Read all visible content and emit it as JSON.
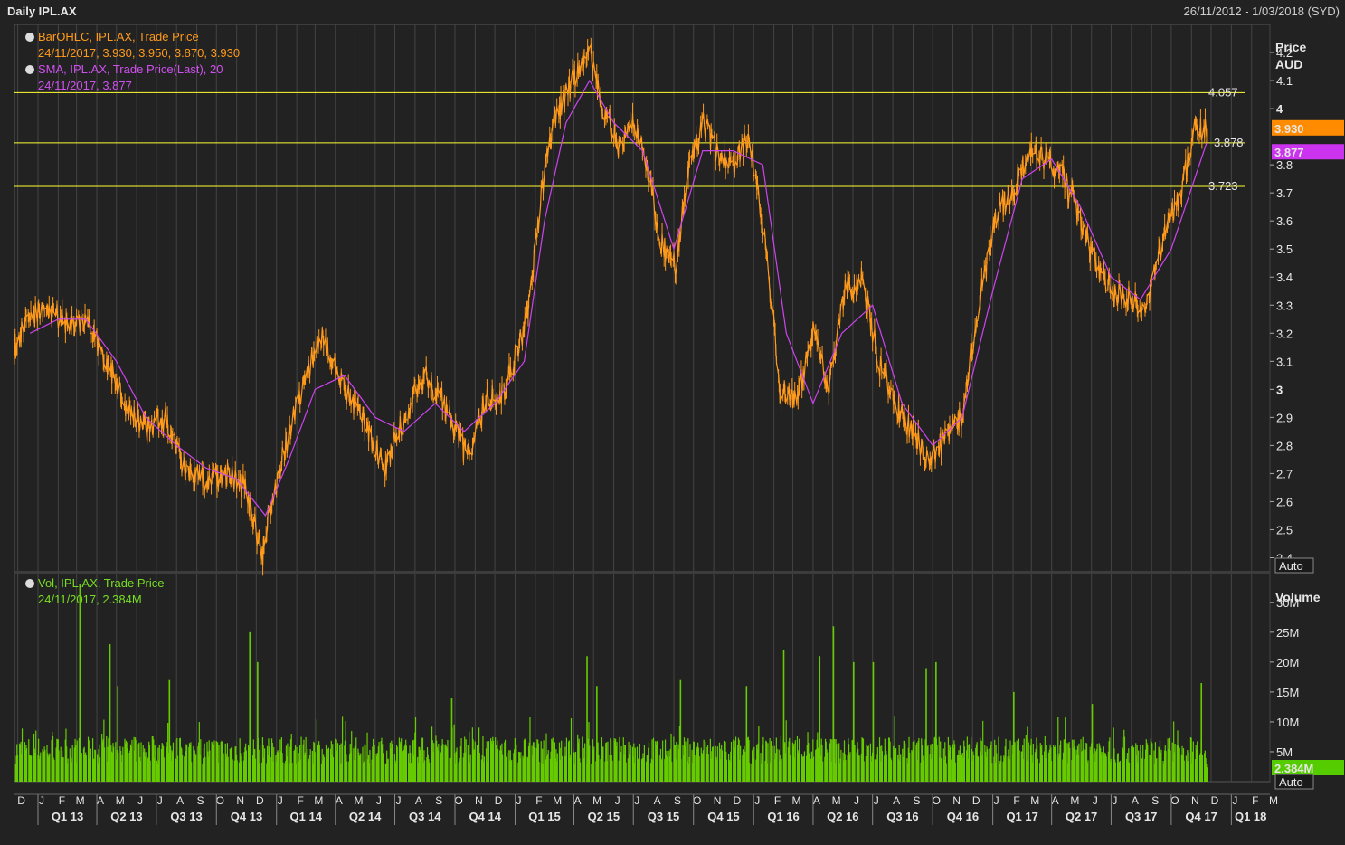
{
  "header": {
    "title": "Daily IPL.AX",
    "date_range": "26/11/2012 - 1/03/2018 (SYD)"
  },
  "legend": {
    "ohlc_label": "BarOHLC, IPL.AX, Trade Price",
    "ohlc_value": "24/11/2017, 3.930, 3.950, 3.870, 3.930",
    "sma_label": "SMA, IPL.AX, Trade Price(Last),  20",
    "sma_value": "24/11/2017, 3.877",
    "vol_label": "Vol, IPL.AX, Trade Price",
    "vol_value": "24/11/2017, 2.384M"
  },
  "colors": {
    "background": "#222222",
    "grid": "#444444",
    "price": "#ff9a1a",
    "sma": "#cc44ee",
    "volume": "#66cc00",
    "hlines": "#ffff33",
    "price_badge": "#ff8c00",
    "sma_badge": "#cc33ee",
    "volume_badge": "#55cc00"
  },
  "price_axis": {
    "title": "Price",
    "unit": "AUD",
    "ticks": [
      "2.4",
      "2.5",
      "2.6",
      "2.7",
      "2.8",
      "2.9",
      "3",
      "3.1",
      "3.2",
      "3.3",
      "3.4",
      "3.5",
      "3.6",
      "3.7",
      "3.8",
      "4",
      "4.1",
      "4.2"
    ],
    "auto_label": "Auto"
  },
  "volume_axis": {
    "title": "Volume",
    "ticks": [
      "5M",
      "10M",
      "15M",
      "20M",
      "25M",
      "30M"
    ],
    "auto_label": "Auto"
  },
  "badges": {
    "last_price": "3.930",
    "last_sma": "3.877",
    "last_volume": "2.384M"
  },
  "hline_labels": [
    "4.057",
    "3.878",
    "3.723"
  ],
  "month_labels": [
    "D",
    "J",
    "F",
    "M",
    "A",
    "M",
    "J",
    "J",
    "A",
    "S",
    "O",
    "N",
    "D",
    "J",
    "F",
    "M",
    "A",
    "M",
    "J",
    "J",
    "A",
    "S",
    "O",
    "N",
    "D",
    "J",
    "F",
    "M",
    "A",
    "M",
    "J",
    "J",
    "A",
    "S",
    "O",
    "N",
    "D",
    "J",
    "F",
    "M",
    "A",
    "M",
    "J",
    "J",
    "A",
    "S",
    "O",
    "N",
    "D",
    "J",
    "F",
    "M",
    "A",
    "M",
    "J",
    "J",
    "A",
    "S",
    "O",
    "N",
    "D",
    "J",
    "F",
    "M",
    "A",
    "M",
    "J",
    "J",
    "A",
    "S",
    "O",
    "N",
    "D",
    "J",
    "F",
    "M"
  ],
  "quarter_labels": [
    "Q1 13",
    "Q2 13",
    "Q3 13",
    "Q4 13",
    "Q1 14",
    "Q2 14",
    "Q3 14",
    "Q4 14",
    "Q1 15",
    "Q2 15",
    "Q3 15",
    "Q4 15",
    "Q1 16",
    "Q2 16",
    "Q3 16",
    "Q4 16",
    "Q1 17",
    "Q2 17",
    "Q3 17",
    "Q4 17",
    "Q1 18"
  ],
  "chart_data": [
    {
      "type": "line",
      "title": "Daily IPL.AX",
      "ylabel": "Price AUD",
      "ylim": [
        2.35,
        4.3
      ],
      "x_range": [
        "2012-11-26",
        "2018-03-01"
      ],
      "horizontal_lines": [
        4.057,
        3.878,
        3.723
      ],
      "series": [
        {
          "name": "BarOHLC, IPL.AX, Trade Price",
          "x": [
            "2012-11-26",
            "2012-12-17",
            "2013-01-15",
            "2013-02-15",
            "2013-03-15",
            "2013-04-15",
            "2013-05-15",
            "2013-06-15",
            "2013-07-15",
            "2013-08-15",
            "2013-09-15",
            "2013-10-15",
            "2013-11-15",
            "2013-12-10",
            "2013-12-20",
            "2014-01-15",
            "2014-02-15",
            "2014-03-10",
            "2014-04-15",
            "2014-05-15",
            "2014-06-15",
            "2014-07-15",
            "2014-08-15",
            "2014-09-15",
            "2014-10-20",
            "2014-11-15",
            "2014-12-15",
            "2015-01-20",
            "2015-02-10",
            "2015-03-01",
            "2015-03-20",
            "2015-04-10",
            "2015-04-25",
            "2015-05-15",
            "2015-06-10",
            "2015-07-01",
            "2015-07-25",
            "2015-08-15",
            "2015-09-05",
            "2015-09-25",
            "2015-10-15",
            "2015-11-05",
            "2015-12-01",
            "2015-12-25",
            "2016-01-20",
            "2016-02-10",
            "2016-03-05",
            "2016-04-01",
            "2016-04-25",
            "2016-05-20",
            "2016-06-15",
            "2016-07-10",
            "2016-08-05",
            "2016-08-30",
            "2016-09-25",
            "2016-10-20",
            "2016-11-15",
            "2016-12-10",
            "2017-01-05",
            "2017-02-01",
            "2017-03-01",
            "2017-03-25",
            "2017-04-20",
            "2017-05-15",
            "2017-06-10",
            "2017-07-05",
            "2017-08-01",
            "2017-08-25",
            "2017-09-20",
            "2017-10-15",
            "2017-11-05",
            "2017-11-24"
          ],
          "y": [
            3.15,
            3.25,
            3.3,
            3.22,
            3.25,
            3.1,
            2.95,
            2.85,
            2.9,
            2.7,
            2.68,
            2.7,
            2.65,
            2.4,
            2.55,
            2.8,
            3.05,
            3.2,
            3.0,
            2.88,
            2.72,
            2.9,
            3.05,
            2.95,
            2.75,
            2.95,
            3.0,
            3.25,
            3.7,
            3.95,
            4.05,
            4.15,
            4.22,
            4.0,
            3.85,
            3.95,
            3.75,
            3.5,
            3.45,
            3.8,
            3.95,
            3.85,
            3.8,
            3.9,
            3.5,
            3.0,
            2.95,
            3.2,
            3.0,
            3.35,
            3.4,
            3.1,
            2.95,
            2.85,
            2.75,
            2.82,
            2.9,
            3.3,
            3.6,
            3.72,
            3.85,
            3.82,
            3.75,
            3.6,
            3.42,
            3.35,
            3.32,
            3.3,
            3.55,
            3.7,
            3.92,
            3.93
          ]
        },
        {
          "name": "SMA, IPL.AX, Trade Price(Last),  20",
          "x": [
            "2012-12-20",
            "2013-02-01",
            "2013-03-15",
            "2013-05-01",
            "2013-06-15",
            "2013-08-01",
            "2013-09-15",
            "2013-11-01",
            "2013-12-15",
            "2014-01-20",
            "2014-03-01",
            "2014-04-15",
            "2014-06-01",
            "2014-07-15",
            "2014-09-01",
            "2014-10-15",
            "2014-12-01",
            "2015-01-15",
            "2015-02-15",
            "2015-03-20",
            "2015-04-25",
            "2015-06-01",
            "2015-07-15",
            "2015-09-01",
            "2015-10-15",
            "2015-12-01",
            "2016-01-15",
            "2016-02-20",
            "2016-04-01",
            "2016-05-15",
            "2016-07-01",
            "2016-08-15",
            "2016-10-01",
            "2016-11-15",
            "2017-01-01",
            "2017-02-15",
            "2017-04-01",
            "2017-05-15",
            "2017-07-01",
            "2017-08-15",
            "2017-10-01",
            "2017-11-24"
          ],
          "y": [
            3.2,
            3.25,
            3.25,
            3.1,
            2.9,
            2.8,
            2.72,
            2.68,
            2.55,
            2.75,
            3.0,
            3.05,
            2.9,
            2.85,
            2.95,
            2.85,
            2.95,
            3.1,
            3.6,
            3.95,
            4.1,
            3.95,
            3.85,
            3.5,
            3.85,
            3.85,
            3.8,
            3.2,
            2.95,
            3.2,
            3.3,
            2.95,
            2.8,
            2.9,
            3.35,
            3.75,
            3.82,
            3.65,
            3.4,
            3.32,
            3.5,
            3.877
          ]
        }
      ]
    },
    {
      "type": "bar",
      "title": "Volume",
      "ylabel": "Volume",
      "ylim": [
        0,
        33000000
      ],
      "x_range": [
        "2012-11-26",
        "2018-03-01"
      ],
      "series": [
        {
          "name": "Vol, IPL.AX, Trade Price",
          "x": [
            "2013-03-05",
            "2013-04-20",
            "2013-05-02",
            "2013-07-20",
            "2013-11-20",
            "2013-12-02",
            "2014-09-25",
            "2015-04-20",
            "2015-05-05",
            "2015-09-10",
            "2015-12-20",
            "2016-02-15",
            "2016-04-10",
            "2016-05-01",
            "2016-06-01",
            "2016-07-01",
            "2016-09-20",
            "2016-10-05",
            "2017-02-01",
            "2017-06-01",
            "2017-11-15",
            "2017-11-24"
          ],
          "y": [
            33000000,
            23000000,
            16000000,
            17000000,
            25000000,
            20000000,
            14000000,
            21000000,
            16000000,
            17000000,
            16000000,
            22000000,
            21000000,
            26000000,
            20000000,
            20000000,
            19000000,
            20000000,
            15000000,
            13000000,
            16500000,
            2384000
          ]
        }
      ]
    }
  ]
}
